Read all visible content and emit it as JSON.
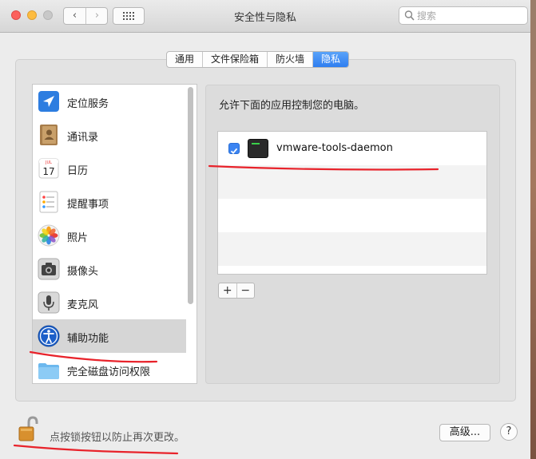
{
  "window": {
    "title": "安全性与隐私",
    "back_glyph": "‹",
    "forward_glyph": "›"
  },
  "search": {
    "placeholder": "搜索"
  },
  "tabs": [
    {
      "label": "通用"
    },
    {
      "label": "文件保险箱"
    },
    {
      "label": "防火墙"
    },
    {
      "label": "隐私",
      "active": true
    }
  ],
  "sidebar": {
    "items": [
      {
        "label": "定位服务",
        "icon": "location-icon"
      },
      {
        "label": "通讯录",
        "icon": "contacts-icon"
      },
      {
        "label": "日历",
        "icon": "calendar-icon",
        "icon_text": "17",
        "icon_month": "JUL"
      },
      {
        "label": "提醒事项",
        "icon": "reminders-icon"
      },
      {
        "label": "照片",
        "icon": "photos-icon"
      },
      {
        "label": "摄像头",
        "icon": "camera-icon"
      },
      {
        "label": "麦克风",
        "icon": "microphone-icon"
      },
      {
        "label": "辅助功能",
        "icon": "accessibility-icon",
        "selected": true
      },
      {
        "label": "完全磁盘访问权限",
        "icon": "folder-icon"
      }
    ]
  },
  "panel": {
    "title": "允许下面的应用控制您的电脑。",
    "apps": [
      {
        "name": "vmware-tools-daemon",
        "checked": true,
        "icon": "terminal-icon"
      }
    ],
    "add_label": "+",
    "remove_label": "−"
  },
  "footer": {
    "lock_text": "点按锁按钮以防止再次更改。",
    "advanced_label": "高级...",
    "help_label": "?"
  },
  "colors": {
    "accent": "#3b84f2",
    "annotation": "#e8232b"
  }
}
